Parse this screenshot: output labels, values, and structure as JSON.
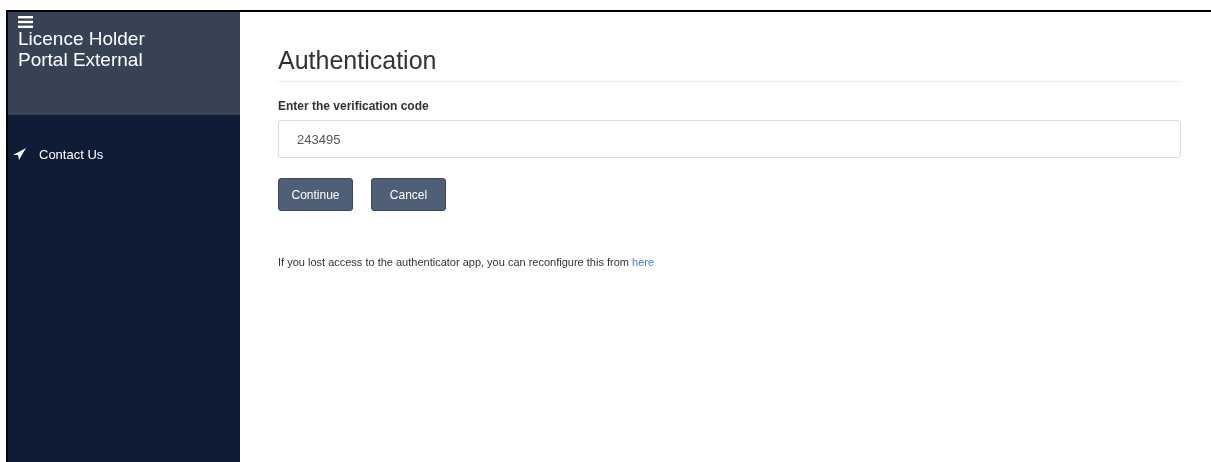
{
  "sidebar": {
    "title": "Licence Holder Portal External",
    "items": [
      {
        "label": "Contact Us",
        "selected": false
      }
    ]
  },
  "main": {
    "heading": "Authentication",
    "field": {
      "label": "Enter the verification code",
      "value": "243495"
    },
    "buttons": [
      "Continue",
      "Cancel"
    ],
    "note": "If you lost access to the authenticator app, you can reconfigure this from",
    "link": "here"
  }
}
